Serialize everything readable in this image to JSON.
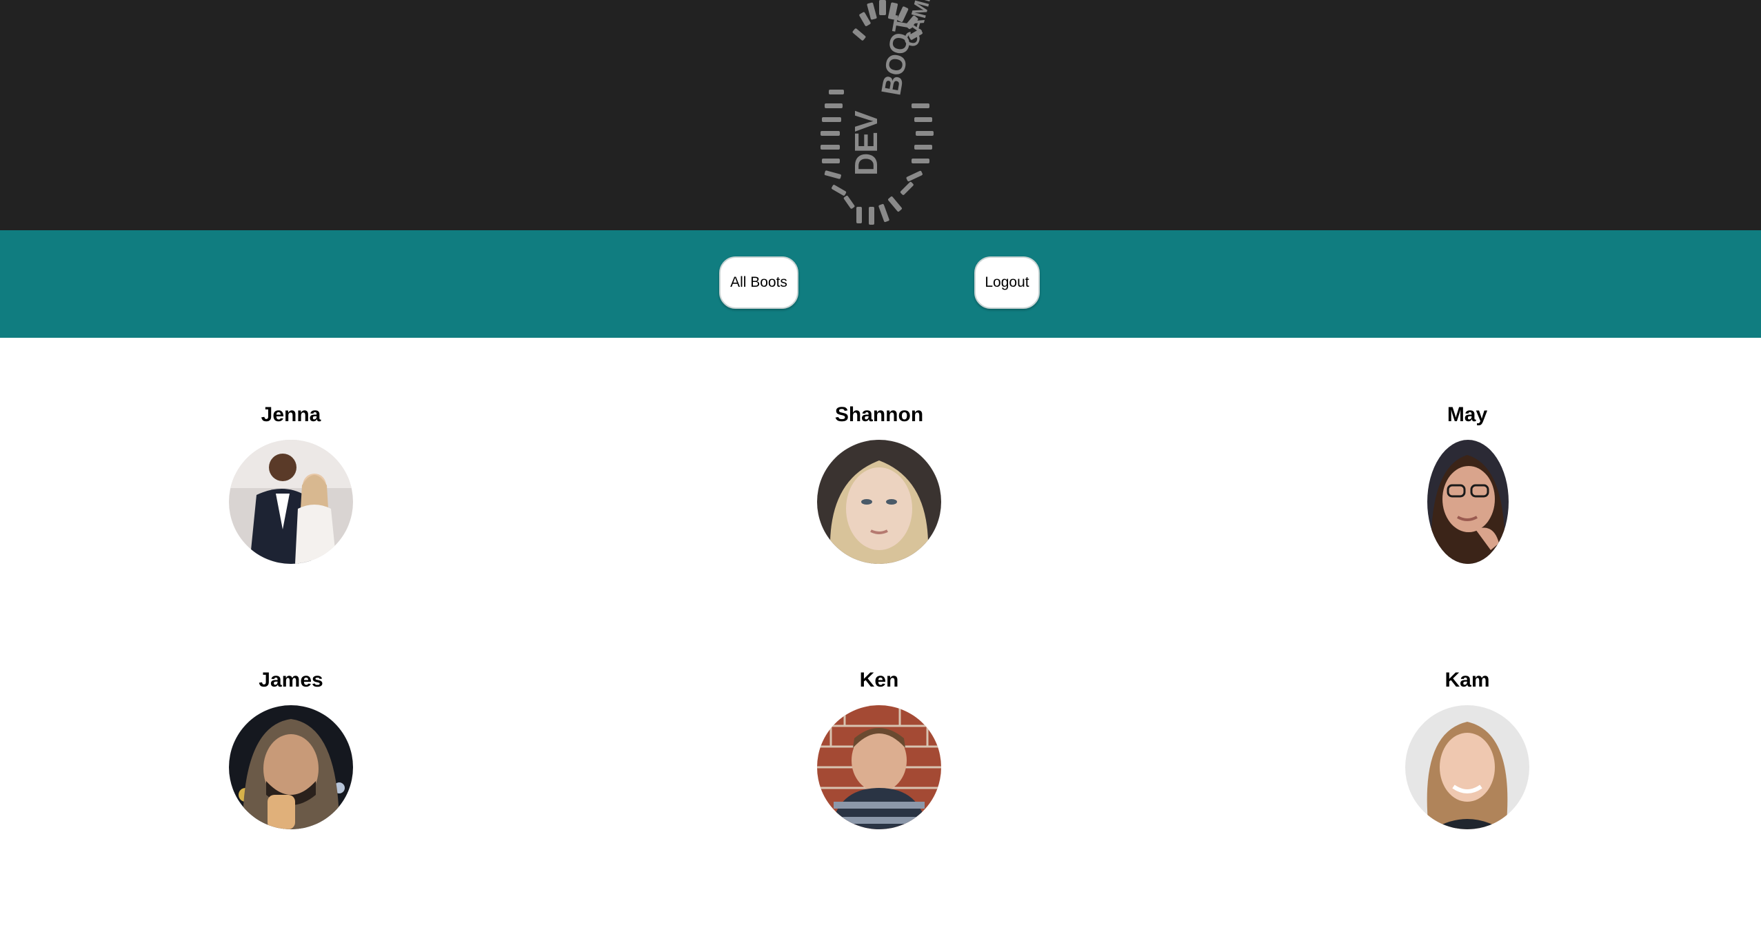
{
  "header": {
    "logo_text": "DEV BOOTCAMP",
    "logo_icon": "bootprint-logo"
  },
  "nav": {
    "all_boots_label": "All Boots",
    "logout_label": "Logout"
  },
  "colors": {
    "header_bg": "#222222",
    "navbar_bg": "#107d80",
    "page_bg": "#ffffff"
  },
  "boots": [
    {
      "name": "Jenna"
    },
    {
      "name": "Shannon"
    },
    {
      "name": "May"
    },
    {
      "name": "James"
    },
    {
      "name": "Ken"
    },
    {
      "name": "Kam"
    }
  ]
}
